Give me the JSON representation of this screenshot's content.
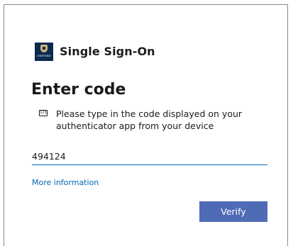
{
  "brand": {
    "logo_text": "OXFORD",
    "title": "Single Sign-On"
  },
  "form": {
    "heading": "Enter code",
    "instruction_icon": "123",
    "instruction": "Please type in the code displayed on your authenticator app from your device",
    "code_value": "494124",
    "more_info_link": "More information",
    "verify_label": "Verify"
  },
  "colors": {
    "primary_button": "#4e6bb5",
    "link": "#0067b8",
    "input_underline": "#0067b8"
  },
  "icons": {
    "logo": "oxford-crest-icon",
    "instruction": "keypad-123-icon"
  }
}
